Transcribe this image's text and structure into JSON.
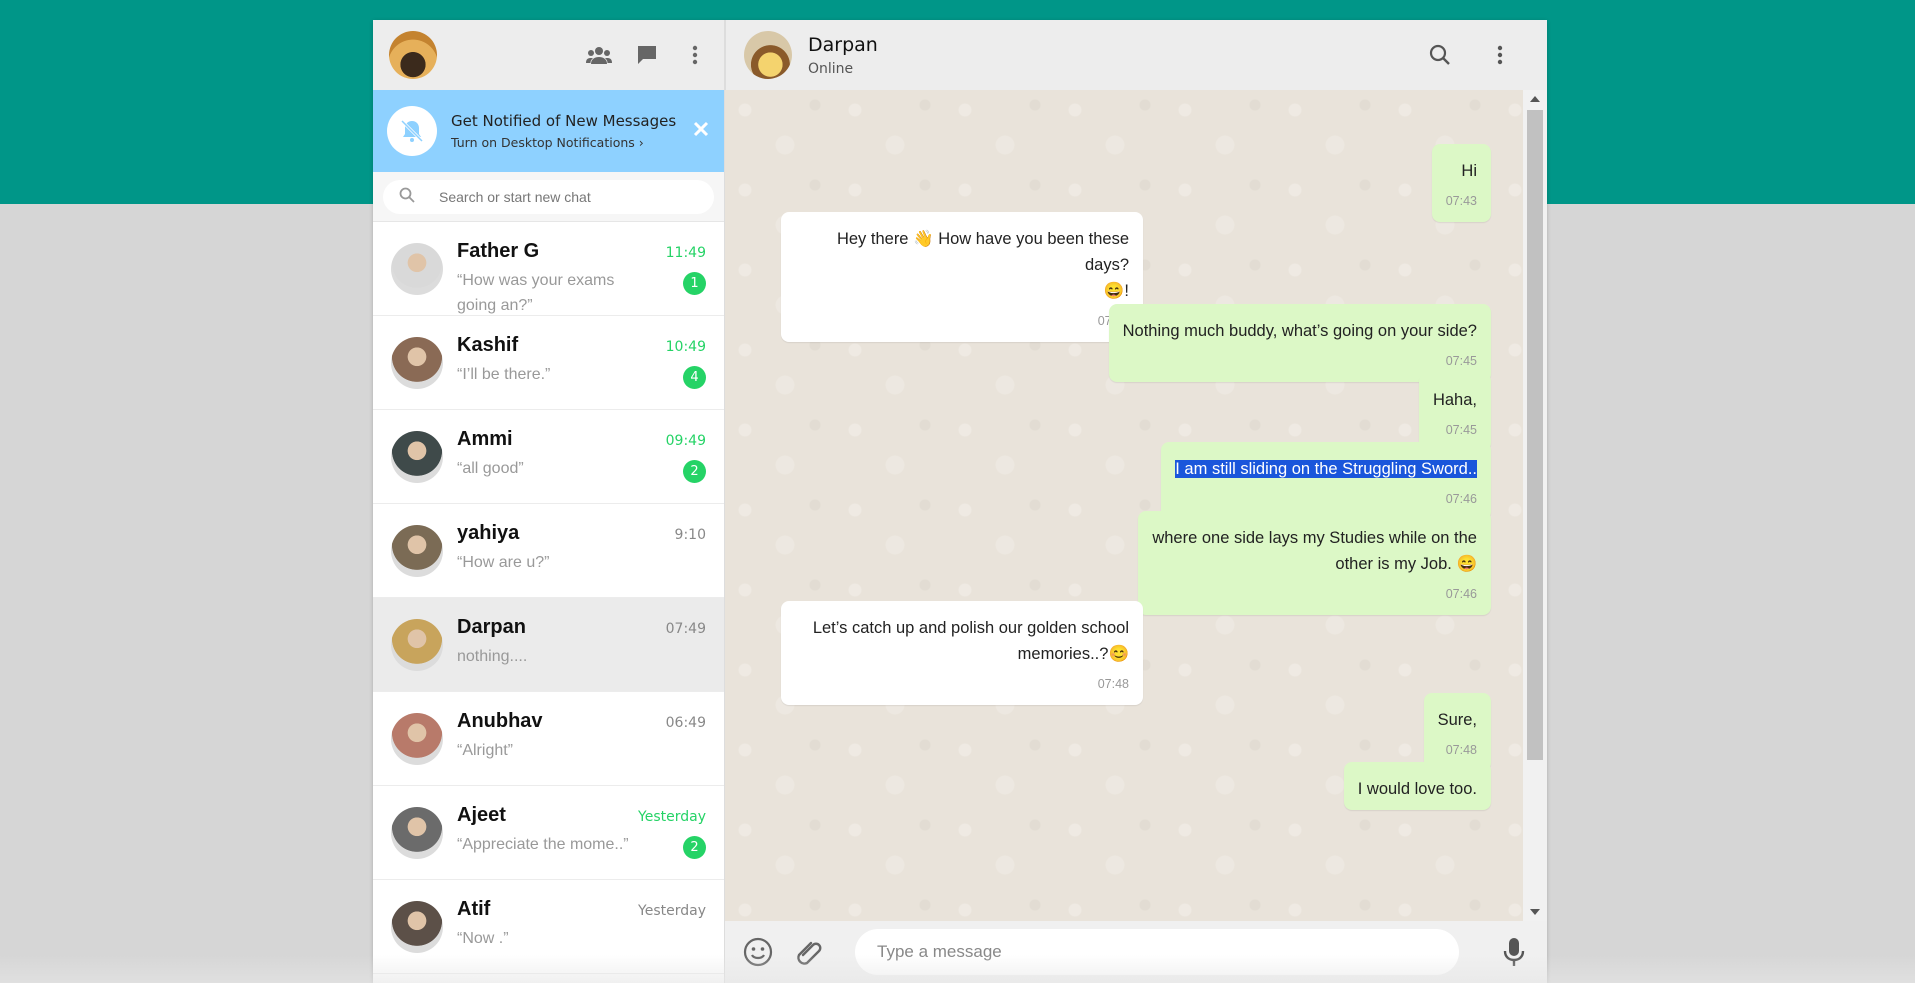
{
  "sidebar": {
    "my_avatar_icon": "profile-photo",
    "header_icons": [
      "community-icon",
      "new-chat-icon",
      "menu-icon"
    ],
    "notification": {
      "title": "Get Notified of New Messages",
      "subtitle": "Turn on Desktop Notifications ›"
    },
    "search": {
      "placeholder": "Search or start new chat"
    },
    "chats": [
      {
        "name": "Father G",
        "time": "11:49",
        "preview": "“How was your exams going an?”",
        "unread": "1",
        "time_unread": true,
        "avatar_color": "#d9d9d9"
      },
      {
        "name": "Kashif",
        "time": "10:49",
        "preview": "“I’ll be there.”",
        "unread": "4",
        "time_unread": true,
        "avatar_color": "#8a6a55"
      },
      {
        "name": "Ammi",
        "time": "09:49",
        "preview": "“all good”",
        "unread": "2",
        "time_unread": true,
        "avatar_color": "#3f4a4a"
      },
      {
        "name": "yahiya",
        "time": "9:10",
        "preview": "“How are u?”",
        "unread": "",
        "time_unread": false,
        "avatar_color": "#7b6b55"
      },
      {
        "name": "Darpan",
        "time": "07:49",
        "preview": "nothing....",
        "unread": "",
        "time_unread": false,
        "avatar_color": "#c8a45c",
        "active": true
      },
      {
        "name": "Anubhav",
        "time": "06:49",
        "preview": "“Alright”",
        "unread": "",
        "time_unread": false,
        "avatar_color": "#b87a6a"
      },
      {
        "name": "Ajeet",
        "time": "Yesterday",
        "preview": "“Appreciate the mome..”",
        "unread": "2",
        "time_unread": true,
        "avatar_color": "#6b6b6b"
      },
      {
        "name": "Atif",
        "time": "Yesterday",
        "preview": "“Now .”",
        "unread": "",
        "time_unread": false,
        "avatar_color": "#5c5048"
      }
    ]
  },
  "conversation": {
    "contact_name": "Darpan",
    "contact_status": "Online",
    "header_icons": [
      "search-icon",
      "menu-icon"
    ],
    "messages": [
      {
        "dir": "out",
        "text": "Hi",
        "time": "07:43"
      },
      {
        "dir": "in",
        "text": "Hey there 👋 How have you been these days?",
        "text2": "😄!",
        "time": "07:45"
      },
      {
        "dir": "out",
        "text": "Nothing much buddy, what’s going on your side?",
        "time": "07:45"
      },
      {
        "dir": "out",
        "text": "Haha,",
        "time": "07:45"
      },
      {
        "dir": "out",
        "text": "I am still sliding on the Struggling Sword..",
        "time": "07:46",
        "highlighted": true
      },
      {
        "dir": "out",
        "text": "where one side lays my Studies while on the",
        "text2": "other is my Job. 😄",
        "time": "07:46"
      },
      {
        "dir": "in",
        "text": "Let’s catch up and polish our golden school",
        "text2": "memories..?😊",
        "time": "07:48"
      },
      {
        "dir": "out",
        "text": "Sure,",
        "time": "07:48"
      },
      {
        "dir": "out",
        "text": "I would love too.",
        "time": ""
      }
    ],
    "compose": {
      "placeholder": "Type a message"
    }
  },
  "colors": {
    "teal": "#009688",
    "outgoing": "#dcf8c6",
    "unread": "#25d366",
    "notification": "#8ed1ff"
  }
}
